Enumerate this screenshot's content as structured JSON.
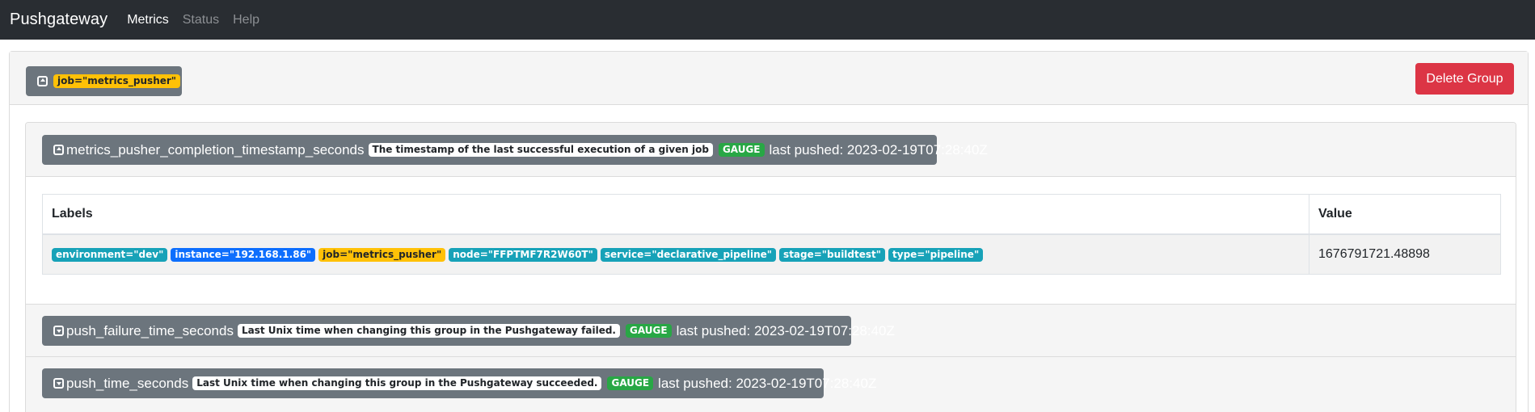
{
  "navbar": {
    "brand": "Pushgateway",
    "links": [
      {
        "label": "Metrics",
        "active": true
      },
      {
        "label": "Status",
        "active": false
      },
      {
        "label": "Help",
        "active": false
      }
    ]
  },
  "group": {
    "job_label": "job=\"metrics_pusher\"",
    "delete_label": "Delete Group"
  },
  "metrics": [
    {
      "name": "metrics_pusher_completion_timestamp_seconds",
      "help": "The timestamp of the last successful execution of a given job",
      "type": "GAUGE",
      "last_pushed": "last pushed: 2023-02-19T07:28:40Z",
      "expanded": true
    },
    {
      "name": "push_failure_time_seconds",
      "help": "Last Unix time when changing this group in the Pushgateway failed.",
      "type": "GAUGE",
      "last_pushed": "last pushed: 2023-02-19T07:28:40Z",
      "expanded": false
    },
    {
      "name": "push_time_seconds",
      "help": "Last Unix time when changing this group in the Pushgateway succeeded.",
      "type": "GAUGE",
      "last_pushed": "last pushed: 2023-02-19T07:28:40Z",
      "expanded": false
    }
  ],
  "table": {
    "headers": {
      "labels": "Labels",
      "value": "Value"
    },
    "row": {
      "labels": [
        "environment=\"dev\"",
        "instance=\"192.168.1.86\"",
        "job=\"metrics_pusher\"",
        "node=\"FFPTMF7R2W60T\"",
        "service=\"declarative_pipeline\"",
        "stage=\"buildtest\"",
        "type=\"pipeline\""
      ],
      "value": "1676791721.48898"
    }
  },
  "colors": {
    "navbar": "#292d32",
    "danger": "#dc3545",
    "secondary": "#6c757d",
    "warning": "#ffc107",
    "info": "#17a2b8",
    "primary": "#0d6efd",
    "success": "#28a745"
  }
}
